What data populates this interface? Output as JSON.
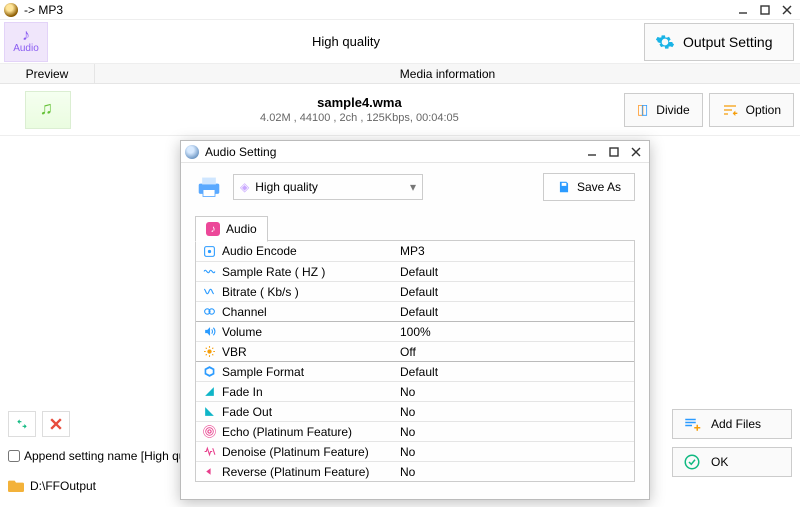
{
  "window": {
    "title": "-> MP3"
  },
  "toolbar": {
    "audio_chip_label": "Audio",
    "quality_label": "High quality",
    "output_setting_label": "Output Setting"
  },
  "columns": {
    "preview": "Preview",
    "media_info": "Media information"
  },
  "file": {
    "name": "sample4.wma",
    "details": "4.02M , 44100 , 2ch , 125Kbps, 00:04:05",
    "divide_label": "Divide",
    "option_label": "Option"
  },
  "bottom": {
    "append_label": "Append setting name [High quality]",
    "output_dir": "D:\\FFOutput",
    "add_files_label": "Add Files",
    "ok_label": "OK"
  },
  "dialog": {
    "title": "Audio Setting",
    "quality_selected": "High quality",
    "save_as_label": "Save As",
    "tab_label": "Audio",
    "rows": [
      {
        "icon": "encode-icon",
        "iconClass": "color-blue",
        "key": "Audio Encode",
        "value": "MP3"
      },
      {
        "icon": "rate-icon",
        "iconClass": "color-blue",
        "key": "Sample Rate ( HZ )",
        "value": "Default"
      },
      {
        "icon": "bitrate-icon",
        "iconClass": "color-blue",
        "key": "Bitrate ( Kb/s )",
        "value": "Default"
      },
      {
        "icon": "channel-icon",
        "iconClass": "color-blue",
        "key": "Channel",
        "value": "Default"
      },
      {
        "icon": "volume-icon",
        "iconClass": "color-blue",
        "key": "Volume",
        "value": "100%",
        "sep": true
      },
      {
        "icon": "vbr-icon",
        "iconClass": "color-orange",
        "key": "VBR",
        "value": "Off"
      },
      {
        "icon": "format-icon",
        "iconClass": "color-blue",
        "key": "Sample Format",
        "value": "Default",
        "sep": true
      },
      {
        "icon": "fadein-icon",
        "iconClass": "color-teal",
        "key": "Fade In",
        "value": "No"
      },
      {
        "icon": "fadeout-icon",
        "iconClass": "color-teal",
        "key": "Fade Out",
        "value": "No"
      },
      {
        "icon": "echo-icon",
        "iconClass": "color-pink",
        "key": "Echo (Platinum Feature)",
        "value": "No"
      },
      {
        "icon": "denoise-icon",
        "iconClass": "color-pink",
        "key": "Denoise (Platinum Feature)",
        "value": "No"
      },
      {
        "icon": "reverse-icon",
        "iconClass": "color-pink",
        "key": "Reverse (Platinum Feature)",
        "value": "No"
      }
    ]
  }
}
